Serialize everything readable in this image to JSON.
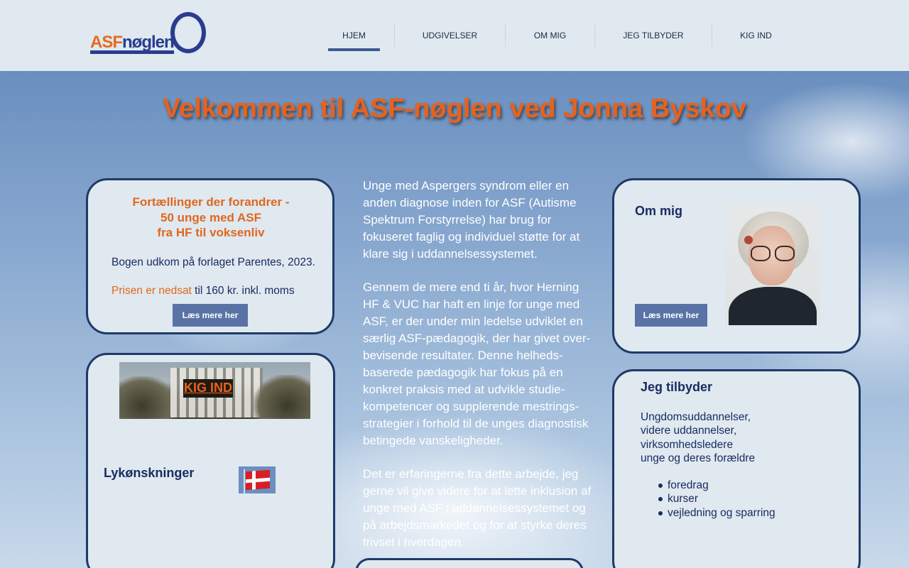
{
  "logo": {
    "part1": "ASF",
    "part2": "nøglen"
  },
  "nav": {
    "items": [
      {
        "label": "HJEM",
        "active": true
      },
      {
        "label": "UDGIVELSER",
        "active": false
      },
      {
        "label": "OM MIG",
        "active": false
      },
      {
        "label": "JEG TILBYDER",
        "active": false
      },
      {
        "label": "KIG IND",
        "active": false
      }
    ]
  },
  "hero": {
    "title": "Velkommen til ASF-nøglen ved Jonna Byskov"
  },
  "book": {
    "title_line1": "Fortællinger der forandrer -",
    "title_line2": "50 unge med ASF",
    "title_line3": "fra HF til voksenliv",
    "text": "Bogen udkom på forlaget Parentes, 2023.",
    "price_highlight": "Prisen er nedsat",
    "price_rest": " til 160 kr. inkl. moms",
    "button": "Læs mere her"
  },
  "kig": {
    "label": "KIG IND"
  },
  "lyk": {
    "label": "Lykønskninger"
  },
  "middle": {
    "p1": "Unge med Aspergers syndrom eller en anden diagnose inden for ASF (Autisme Spektrum Forstyrrelse) har brug for fokuseret faglig og individuel støtte for at klare sig i uddannelsessystemet.",
    "p2": "Gennem de mere end ti år, hvor Herning HF & VUC har haft en linje for unge med ASF, er der under min ledelse udviklet en særlig ASF-pædagogik, der har givet over-bevisende resultater. Denne helheds-baserede pædagogik har fokus på en konkret praksis med  at udvikle studie-kompetencer og supplerende mestrings-strategier i forhold til de unges diagnostisk betingede vanskeligheder.",
    "p3": "Det er erfaringerne fra dette arbejde, jeg gerne vil give videre for at lette inklusion af unge med ASF i uddannelsessystemet og på arbejdsmarkedet og for at styrke deres trivsel i hverdagen."
  },
  "om": {
    "title": "Om mig",
    "button": "Læs mere her"
  },
  "tilbyder": {
    "title": "Jeg tilbyder",
    "line1": "Ungdomsuddannelser,",
    "line2": "videre uddannelser,",
    "line3": "virksomhedsledere",
    "line4": "unge og deres forældre",
    "items": [
      "foredrag",
      "kurser",
      "vejledning og sparring"
    ]
  }
}
